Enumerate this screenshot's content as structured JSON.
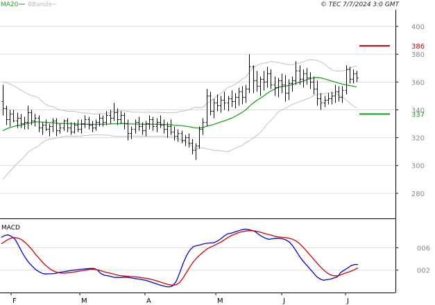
{
  "header": {
    "legend": [
      {
        "label": "MA20",
        "color": "#1fa01f"
      },
      {
        "label": "BBands",
        "color": "#c8c8c8"
      }
    ],
    "copyright": "© TEC 7/7/2024 3:0 GMT"
  },
  "chart_data": [
    {
      "type": "ohlc-line",
      "panel": "price",
      "x": [
        "F",
        "M",
        "A",
        "M",
        "J",
        "J"
      ],
      "y_ticks": [
        280,
        300,
        320,
        340,
        360,
        380,
        400
      ],
      "ylim": [
        262,
        412
      ],
      "grid": true,
      "price_bars": [
        [
          346,
          358,
          336,
          341
        ],
        [
          341,
          343,
          329,
          333
        ],
        [
          333,
          340,
          328,
          337
        ],
        [
          337,
          340,
          331,
          332
        ],
        [
          332,
          338,
          327,
          334
        ],
        [
          334,
          337,
          327,
          330
        ],
        [
          330,
          335,
          326,
          331
        ],
        [
          331,
          343,
          326,
          338
        ],
        [
          338,
          340,
          329,
          332
        ],
        [
          332,
          337,
          328,
          334
        ],
        [
          334,
          336,
          324,
          327
        ],
        [
          327,
          331,
          322,
          329
        ],
        [
          329,
          333,
          325,
          326
        ],
        [
          326,
          330,
          321,
          328
        ],
        [
          328,
          334,
          324,
          332
        ],
        [
          332,
          334,
          321,
          325
        ],
        [
          325,
          330,
          323,
          327
        ],
        [
          327,
          333,
          325,
          332
        ],
        [
          332,
          334,
          324,
          327
        ],
        [
          327,
          331,
          322,
          324
        ],
        [
          324,
          331,
          323,
          329
        ],
        [
          329,
          333,
          324,
          326
        ],
        [
          326,
          333,
          323,
          330
        ],
        [
          330,
          336,
          327,
          333
        ],
        [
          333,
          335,
          326,
          329
        ],
        [
          329,
          332,
          324,
          327
        ],
        [
          327,
          333,
          325,
          331
        ],
        [
          331,
          337,
          328,
          334
        ],
        [
          334,
          336,
          328,
          331
        ],
        [
          331,
          339,
          329,
          336
        ],
        [
          336,
          340,
          330,
          334
        ],
        [
          334,
          345,
          332,
          338
        ],
        [
          338,
          341,
          329,
          333
        ],
        [
          333,
          339,
          330,
          336
        ],
        [
          336,
          338,
          326,
          330
        ],
        [
          330,
          333,
          318,
          323
        ],
        [
          323,
          328,
          319,
          326
        ],
        [
          326,
          333,
          323,
          331
        ],
        [
          331,
          335,
          325,
          328
        ],
        [
          328,
          331,
          322,
          325
        ],
        [
          325,
          332,
          321,
          330
        ],
        [
          330,
          336,
          326,
          333
        ],
        [
          333,
          335,
          325,
          328
        ],
        [
          328,
          334,
          324,
          331
        ],
        [
          331,
          336,
          327,
          329
        ],
        [
          329,
          333,
          323,
          326
        ],
        [
          326,
          331,
          320,
          328
        ],
        [
          328,
          333,
          322,
          324
        ],
        [
          324,
          328,
          318,
          321
        ],
        [
          321,
          326,
          317,
          323
        ],
        [
          323,
          325,
          316,
          318
        ],
        [
          318,
          322,
          314,
          320
        ],
        [
          320,
          323,
          313,
          316
        ],
        [
          316,
          319,
          308,
          311
        ],
        [
          311,
          316,
          304,
          314
        ],
        [
          314,
          328,
          312,
          326
        ],
        [
          326,
          334,
          322,
          331
        ],
        [
          331,
          355,
          328,
          350
        ],
        [
          350,
          353,
          336,
          339
        ],
        [
          339,
          348,
          334,
          345
        ],
        [
          345,
          351,
          339,
          343
        ],
        [
          343,
          350,
          338,
          347
        ],
        [
          347,
          353,
          340,
          345
        ],
        [
          345,
          350,
          339,
          348
        ],
        [
          348,
          354,
          342,
          346
        ],
        [
          346,
          352,
          341,
          349
        ],
        [
          349,
          356,
          343,
          353
        ],
        [
          353,
          357,
          344,
          349
        ],
        [
          349,
          358,
          345,
          355
        ],
        [
          355,
          380,
          352,
          371
        ],
        [
          371,
          372,
          352,
          361
        ],
        [
          361,
          368,
          353,
          357
        ],
        [
          357,
          364,
          350,
          362
        ],
        [
          362,
          368,
          354,
          360
        ],
        [
          360,
          371,
          356,
          366
        ],
        [
          366,
          369,
          355,
          358
        ],
        [
          358,
          364,
          350,
          356
        ],
        [
          356,
          363,
          349,
          361
        ],
        [
          361,
          366,
          352,
          358
        ],
        [
          358,
          365,
          346,
          352
        ],
        [
          352,
          362,
          347,
          359
        ],
        [
          359,
          364,
          353,
          361
        ],
        [
          361,
          375,
          358,
          368
        ],
        [
          368,
          372,
          358,
          362
        ],
        [
          362,
          369,
          356,
          366
        ],
        [
          366,
          370,
          358,
          363
        ],
        [
          363,
          367,
          355,
          360
        ],
        [
          360,
          364,
          351,
          355
        ],
        [
          355,
          361,
          343,
          348
        ],
        [
          348,
          352,
          340,
          345
        ],
        [
          345,
          350,
          342,
          347
        ],
        [
          347,
          352,
          344,
          348
        ],
        [
          348,
          353,
          344,
          350
        ],
        [
          350,
          358,
          345,
          353
        ],
        [
          353,
          357,
          346,
          349
        ],
        [
          349,
          357,
          345,
          354
        ],
        [
          354,
          372,
          351,
          369
        ],
        [
          369,
          371,
          359,
          362
        ],
        [
          362,
          369,
          359,
          366
        ],
        [
          366,
          368,
          360,
          363
        ]
      ],
      "ma20": [
        325.0,
        326.3,
        327.3,
        328.0,
        328.7,
        329.0,
        329.5,
        330.4,
        330.7,
        331.3,
        331.3,
        331.2,
        331.0,
        330.8,
        330.8,
        330.4,
        330.1,
        330.2,
        330.1,
        330.0,
        330.0,
        329.7,
        329.6,
        329.6,
        329.6,
        329.5,
        329.5,
        329.6,
        329.6,
        329.7,
        329.8,
        330.0,
        330.0,
        330.1,
        330.1,
        330.0,
        329.8,
        329.8,
        329.7,
        329.6,
        329.6,
        329.7,
        329.6,
        329.6,
        329.6,
        329.5,
        329.4,
        329.3,
        329.0,
        328.8,
        328.6,
        328.3,
        328.0,
        327.5,
        327.0,
        327.0,
        327.3,
        328.2,
        328.8,
        329.5,
        330.4,
        331.3,
        332.0,
        333.0,
        334.0,
        335.3,
        336.8,
        338.3,
        340.0,
        342.6,
        344.8,
        346.7,
        348.3,
        350.0,
        351.9,
        353.6,
        354.8,
        356.2,
        356.8,
        357.0,
        357.5,
        358.2,
        359.0,
        359.8,
        360.6,
        361.6,
        362.4,
        363.1,
        363.3,
        363.0,
        362.3,
        361.5,
        360.7,
        360.0,
        359.2,
        358.6,
        358.0,
        357.5,
        357.0,
        356.5
      ],
      "bb_upper": [
        360.0,
        359.5,
        358.7,
        357.3,
        356.0,
        354.2,
        352.8,
        351.4,
        350.2,
        349.8,
        348.6,
        346.0,
        344.0,
        342.7,
        342.4,
        341.0,
        340.0,
        339.6,
        339.0,
        339.0,
        339.0,
        338.3,
        338.0,
        337.6,
        337.6,
        337.0,
        337.0,
        337.2,
        337.2,
        337.6,
        337.8,
        339.0,
        339.0,
        339.3,
        339.3,
        339.0,
        338.5,
        338.4,
        338.3,
        338.2,
        338.2,
        338.4,
        338.2,
        338.2,
        338.1,
        338.0,
        338.0,
        337.9,
        338.0,
        338.4,
        339.0,
        339.4,
        340.0,
        341.0,
        342.0,
        341.5,
        341.8,
        344.5,
        346.0,
        348.0,
        350.0,
        352.0,
        353.8,
        356.0,
        357.0,
        358.3,
        360.0,
        362.3,
        363.5,
        367.5,
        370.0,
        372.0,
        373.0,
        373.5,
        374.0,
        374.8,
        374.5,
        374.0,
        373.5,
        373.0,
        372.5,
        372.5,
        373.3,
        373.8,
        374.5,
        375.5,
        376.0,
        376.0,
        375.5,
        374.5,
        373.0,
        370.8,
        369.0,
        368.0,
        367.8,
        368.0,
        368.6,
        370.0,
        371.0,
        371.5
      ],
      "bb_lower": [
        290.0,
        293.0,
        295.9,
        298.7,
        301.4,
        303.8,
        306.2,
        309.4,
        311.2,
        312.8,
        314.0,
        316.4,
        318.0,
        318.9,
        319.2,
        319.8,
        320.2,
        320.8,
        321.2,
        321.0,
        321.0,
        321.1,
        321.2,
        321.6,
        321.6,
        322.0,
        322.0,
        322.0,
        322.0,
        321.8,
        321.8,
        321.0,
        321.0,
        320.9,
        320.9,
        321.0,
        321.1,
        321.2,
        321.1,
        321.0,
        321.0,
        321.0,
        321.0,
        321.0,
        321.1,
        321.0,
        320.8,
        320.7,
        320.0,
        319.2,
        318.2,
        317.2,
        316.0,
        314.0,
        312.0,
        312.5,
        312.8,
        311.9,
        311.6,
        311.0,
        310.8,
        310.6,
        310.2,
        310.0,
        311.0,
        312.3,
        313.6,
        314.3,
        316.5,
        317.7,
        319.6,
        321.4,
        323.6,
        326.5,
        329.8,
        332.4,
        335.1,
        338.4,
        340.1,
        341.0,
        342.5,
        343.9,
        344.7,
        345.8,
        346.7,
        347.7,
        348.8,
        350.2,
        351.1,
        351.5,
        351.6,
        352.2,
        352.4,
        352.0,
        350.6,
        349.2,
        347.4,
        345.0,
        343.0,
        341.5
      ],
      "levels": [
        {
          "label": "386",
          "value": 386,
          "color": "#cc0000"
        },
        {
          "label": "337",
          "value": 337,
          "color": "#119911"
        }
      ]
    },
    {
      "type": "line",
      "panel": "indicator",
      "title": "MACD",
      "x": [
        "F",
        "M",
        "A",
        "M",
        "J",
        "J"
      ],
      "y_ticks": [
        2,
        6
      ],
      "y_tick_labels": [
        "002",
        "006"
      ],
      "ylim": [
        -2,
        11
      ],
      "grid": true,
      "series": [
        {
          "color": "#0000cc",
          "values": [
            7.85,
            8.2,
            8.3,
            8.0,
            7.5,
            6.4,
            5.2,
            4.2,
            3.35,
            2.7,
            2.1,
            1.7,
            1.4,
            1.3,
            1.35,
            1.35,
            1.45,
            1.6,
            1.7,
            1.8,
            1.9,
            2.0,
            2.05,
            2.15,
            2.2,
            2.25,
            2.3,
            2.3,
            2.0,
            1.4,
            1.1,
            1.0,
            0.85,
            0.7,
            0.7,
            0.7,
            0.75,
            0.7,
            0.6,
            0.5,
            0.4,
            0.3,
            0.2,
            0.0,
            -0.2,
            -0.4,
            -0.6,
            -0.8,
            -0.95,
            -1.0,
            -0.8,
            0.0,
            1.5,
            3.2,
            4.6,
            5.6,
            6.2,
            6.4,
            6.5,
            6.7,
            6.8,
            6.85,
            6.9,
            7.2,
            7.6,
            8.1,
            8.5,
            8.6,
            8.8,
            9.0,
            9.2,
            9.3,
            9.25,
            9.1,
            8.9,
            8.4,
            8.0,
            7.7,
            7.5,
            7.6,
            7.7,
            7.7,
            7.6,
            7.4,
            7.0,
            6.3,
            5.4,
            4.4,
            3.6,
            2.9,
            2.2,
            1.5,
            0.8,
            0.4,
            0.2,
            0.3,
            0.4,
            0.6,
            0.8,
            1.6,
            2.0,
            2.4,
            2.8,
            3.0,
            3.0
          ]
        },
        {
          "color": "#cc0000",
          "values": [
            6.7,
            7.1,
            7.5,
            7.75,
            7.8,
            7.7,
            7.4,
            6.9,
            6.3,
            5.6,
            4.8,
            4.1,
            3.4,
            2.8,
            2.3,
            1.9,
            1.65,
            1.5,
            1.45,
            1.5,
            1.55,
            1.65,
            1.75,
            1.85,
            1.95,
            2.05,
            2.15,
            2.15,
            2.05,
            1.9,
            1.7,
            1.55,
            1.4,
            1.25,
            1.1,
            1.0,
            0.95,
            0.9,
            0.85,
            0.8,
            0.75,
            0.65,
            0.55,
            0.45,
            0.3,
            0.15,
            -0.05,
            -0.25,
            -0.45,
            -0.6,
            -0.7,
            -0.6,
            -0.2,
            0.6,
            1.6,
            2.6,
            3.5,
            4.2,
            4.8,
            5.3,
            5.8,
            6.1,
            6.4,
            6.7,
            7.0,
            7.4,
            7.8,
            8.15,
            8.4,
            8.65,
            8.85,
            8.95,
            9.05,
            9.05,
            9.0,
            8.85,
            8.7,
            8.5,
            8.35,
            8.2,
            8.0,
            7.9,
            7.85,
            7.8,
            7.7,
            7.5,
            7.2,
            6.7,
            6.1,
            5.4,
            4.7,
            4.0,
            3.3,
            2.6,
            2.0,
            1.5,
            1.15,
            1.0,
            1.0,
            1.15,
            1.4,
            1.6,
            1.8,
            2.1,
            2.4
          ]
        }
      ]
    }
  ]
}
